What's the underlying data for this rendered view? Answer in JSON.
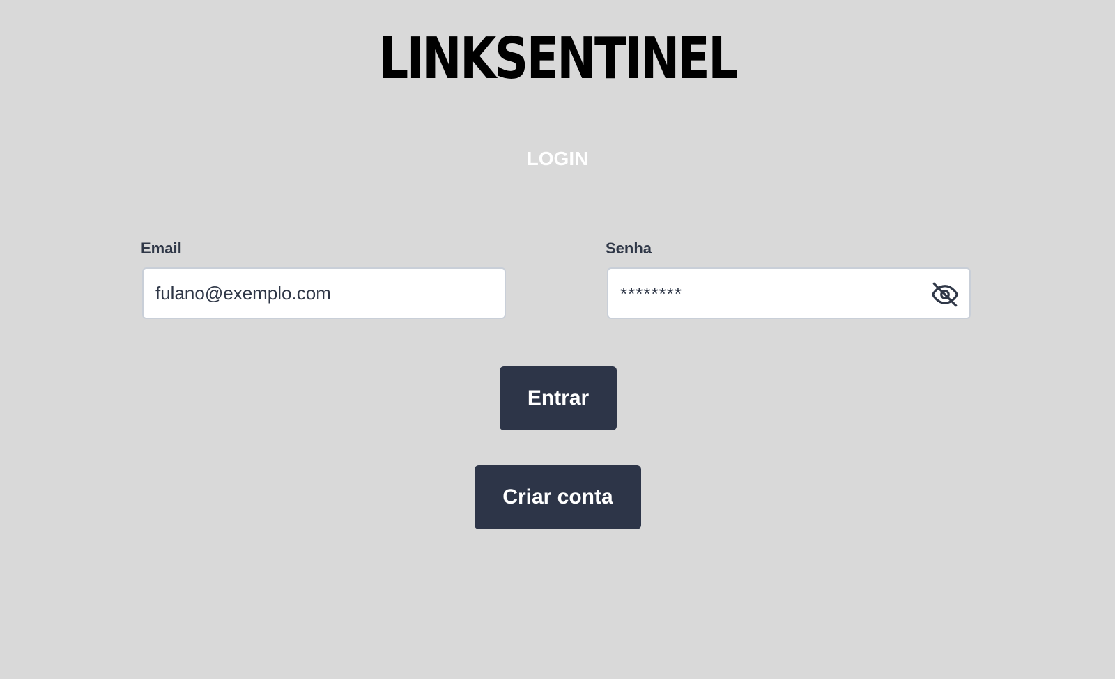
{
  "app": {
    "logo_text": "LINKSENTINEL",
    "page_heading": "LOGIN"
  },
  "form": {
    "email": {
      "label": "Email",
      "value": "fulano@exemplo.com"
    },
    "password": {
      "label": "Senha",
      "masked_value": "********",
      "visibility_icon": "eye-off-icon"
    }
  },
  "buttons": {
    "login_label": "Entrar",
    "create_account_label": "Criar conta"
  },
  "colors": {
    "background": "#d9d9d9",
    "button": "#2d3548",
    "label_text": "#2f3747",
    "heading": "#ffffff"
  }
}
